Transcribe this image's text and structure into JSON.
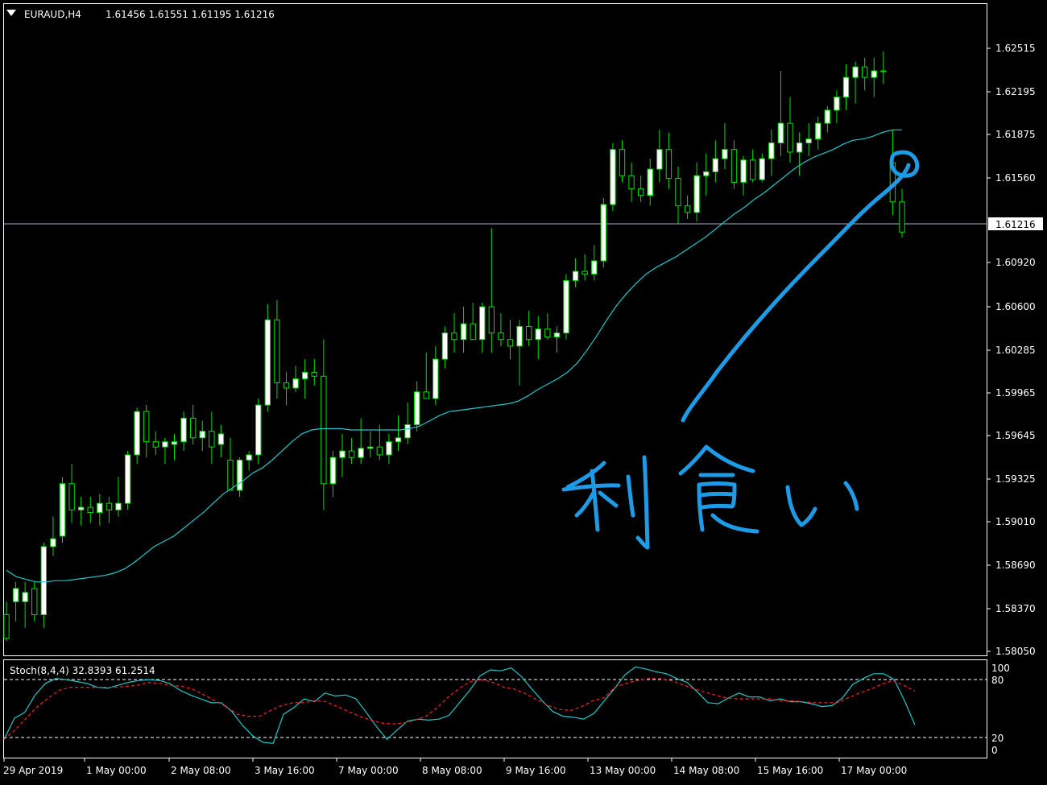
{
  "header": {
    "symbol": "EURAUD,H4",
    "ohlc": "1.61456 1.61551 1.61195 1.61216"
  },
  "stoch": {
    "label": "Stoch(8,4,4) 32.8393 61.2514",
    "levels": [
      "100",
      "80",
      "20",
      "0"
    ]
  },
  "annotation": {
    "text": "利食い"
  },
  "colors": {
    "background": "#000000",
    "frame": "#ffffff",
    "candle_up_body": "#ffffff",
    "candle_wick": "#00e000",
    "moving_average": "#20c8c8",
    "stoch_main": "#20c8c8",
    "stoch_signal": "#ff2020",
    "current_price_line": "#a0b4c8",
    "annotation": "#1e9be6"
  },
  "chart_data": [
    {
      "type": "line",
      "subtype": "candlestick",
      "title": "EURAUD,H4",
      "y_ticks": [
        "1.62515",
        "1.62195",
        "1.61875",
        "1.61560",
        "1.61216",
        "1.60920",
        "1.60600",
        "1.60285",
        "1.59965",
        "1.59645",
        "1.59325",
        "1.59010",
        "1.58690",
        "1.58370",
        "1.58050"
      ],
      "current_price": "1.61216",
      "x_ticks": [
        "29 Apr 2019",
        "1 May 00:00",
        "2 May 08:00",
        "3 May 16:00",
        "7 May 00:00",
        "8 May 08:00",
        "9 May 16:00",
        "13 May 00:00",
        "14 May 08:00",
        "15 May 16:00",
        "17 May 00:00"
      ],
      "ylim": [
        1.5799,
        1.6296
      ],
      "candles": [
        [
          1.583,
          1.584,
          1.581,
          1.5812
        ],
        [
          1.584,
          1.5855,
          1.5825,
          1.585
        ],
        [
          1.584,
          1.5855,
          1.582,
          1.5847
        ],
        [
          1.585,
          1.5855,
          1.5825,
          1.583
        ],
        [
          1.583,
          1.5885,
          1.582,
          1.5882
        ],
        [
          1.5882,
          1.5905,
          1.5875,
          1.5888
        ],
        [
          1.589,
          1.5935,
          1.5885,
          1.593
        ],
        [
          1.593,
          1.5945,
          1.59,
          1.591
        ],
        [
          1.591,
          1.592,
          1.5898,
          1.5912
        ],
        [
          1.5912,
          1.592,
          1.59,
          1.5908
        ],
        [
          1.5908,
          1.5922,
          1.5898,
          1.5915
        ],
        [
          1.5915,
          1.592,
          1.59,
          1.591
        ],
        [
          1.591,
          1.5935,
          1.5905,
          1.5915
        ],
        [
          1.5915,
          1.5955,
          1.591,
          1.5952
        ],
        [
          1.5952,
          1.5988,
          1.5945,
          1.5985
        ],
        [
          1.5985,
          1.599,
          1.595,
          1.5962
        ],
        [
          1.5962,
          1.597,
          1.5952,
          1.5958
        ],
        [
          1.5958,
          1.5965,
          1.5945,
          1.5962
        ],
        [
          1.596,
          1.5968,
          1.5948,
          1.5962
        ],
        [
          1.5962,
          1.5985,
          1.5955,
          1.598
        ],
        [
          1.598,
          1.599,
          1.596,
          1.5965
        ],
        [
          1.5965,
          1.5978,
          1.5955,
          1.597
        ],
        [
          1.597,
          1.5985,
          1.5945,
          1.5958
        ],
        [
          1.596,
          1.5975,
          1.595,
          1.5968
        ],
        [
          1.5948,
          1.5965,
          1.593,
          1.5925
        ],
        [
          1.5925,
          1.595,
          1.592,
          1.5948
        ],
        [
          1.5948,
          1.5955,
          1.594,
          1.5952
        ],
        [
          1.5952,
          1.5995,
          1.5945,
          1.599
        ],
        [
          1.599,
          1.6067,
          1.5985,
          1.6055
        ],
        [
          1.6055,
          1.607,
          1.5995,
          1.6007
        ],
        [
          1.6007,
          1.6015,
          1.599,
          1.6003
        ],
        [
          1.6003,
          1.602,
          1.6,
          1.601
        ],
        [
          1.601,
          1.6025,
          1.5995,
          1.6015
        ],
        [
          1.6015,
          1.6025,
          1.6005,
          1.6012
        ],
        [
          1.6012,
          1.604,
          1.591,
          1.593
        ],
        [
          1.593,
          1.5955,
          1.592,
          1.595
        ],
        [
          1.595,
          1.5968,
          1.5935,
          1.5955
        ],
        [
          1.5955,
          1.5965,
          1.5945,
          1.595
        ],
        [
          1.595,
          1.598,
          1.5945,
          1.5957
        ],
        [
          1.5957,
          1.597,
          1.595,
          1.5958
        ],
        [
          1.5958,
          1.5975,
          1.5948,
          1.5952
        ],
        [
          1.5952,
          1.5968,
          1.5945,
          1.5962
        ],
        [
          1.5962,
          1.5982,
          1.5955,
          1.5965
        ],
        [
          1.5965,
          1.5992,
          1.596,
          1.5975
        ],
        [
          1.5975,
          1.6008,
          1.597,
          1.6
        ],
        [
          1.6,
          1.603,
          1.5995,
          1.5995
        ],
        [
          1.5995,
          1.6035,
          1.599,
          1.6025
        ],
        [
          1.6025,
          1.605,
          1.6018,
          1.6045
        ],
        [
          1.6045,
          1.606,
          1.603,
          1.604
        ],
        [
          1.604,
          1.6065,
          1.603,
          1.6052
        ],
        [
          1.6052,
          1.6068,
          1.604,
          1.604
        ],
        [
          1.604,
          1.6068,
          1.603,
          1.6065
        ],
        [
          1.6065,
          1.6125,
          1.603,
          1.6045
        ],
        [
          1.6045,
          1.606,
          1.6035,
          1.604
        ],
        [
          1.604,
          1.6055,
          1.6025,
          1.6035
        ],
        [
          1.6035,
          1.6055,
          1.6005,
          1.605
        ],
        [
          1.605,
          1.6062,
          1.6035,
          1.604
        ],
        [
          1.604,
          1.6058,
          1.6025,
          1.6048
        ],
        [
          1.6048,
          1.606,
          1.604,
          1.6042
        ],
        [
          1.6042,
          1.605,
          1.603,
          1.6045
        ],
        [
          1.6045,
          1.609,
          1.604,
          1.6085
        ],
        [
          1.6085,
          1.6102,
          1.608,
          1.6092
        ],
        [
          1.6092,
          1.6105,
          1.6085,
          1.609
        ],
        [
          1.609,
          1.6112,
          1.6085,
          1.61
        ],
        [
          1.61,
          1.6148,
          1.6095,
          1.6143
        ],
        [
          1.6143,
          1.619,
          1.6138,
          1.6185
        ],
        [
          1.6185,
          1.6192,
          1.616,
          1.6165
        ],
        [
          1.6165,
          1.6175,
          1.6145,
          1.6155
        ],
        [
          1.6155,
          1.6165,
          1.6145,
          1.615
        ],
        [
          1.615,
          1.6178,
          1.6142,
          1.617
        ],
        [
          1.617,
          1.62,
          1.616,
          1.6185
        ],
        [
          1.6185,
          1.6198,
          1.6155,
          1.6163
        ],
        [
          1.6163,
          1.6172,
          1.6128,
          1.6142
        ],
        [
          1.6142,
          1.615,
          1.6132,
          1.6137
        ],
        [
          1.6137,
          1.6175,
          1.613,
          1.6165
        ],
        [
          1.6165,
          1.6182,
          1.615,
          1.6168
        ],
        [
          1.6168,
          1.6192,
          1.616,
          1.6178
        ],
        [
          1.6178,
          1.6205,
          1.617,
          1.6185
        ],
        [
          1.6185,
          1.6192,
          1.6155,
          1.616
        ],
        [
          1.616,
          1.618,
          1.615,
          1.6177
        ],
        [
          1.6177,
          1.6185,
          1.616,
          1.6162
        ],
        [
          1.6162,
          1.6182,
          1.616,
          1.6178
        ],
        [
          1.6178,
          1.62,
          1.6165,
          1.619
        ],
        [
          1.619,
          1.6245,
          1.618,
          1.6205
        ],
        [
          1.6205,
          1.6225,
          1.6175,
          1.6183
        ],
        [
          1.6183,
          1.6198,
          1.6165,
          1.619
        ],
        [
          1.619,
          1.6205,
          1.618,
          1.6193
        ],
        [
          1.6193,
          1.621,
          1.6185,
          1.6205
        ],
        [
          1.6205,
          1.6218,
          1.6198,
          1.6215
        ],
        [
          1.6215,
          1.623,
          1.6205,
          1.6225
        ],
        [
          1.6225,
          1.625,
          1.6215,
          1.624
        ],
        [
          1.624,
          1.6252,
          1.622,
          1.6248
        ],
        [
          1.6248,
          1.6255,
          1.623,
          1.624
        ],
        [
          1.624,
          1.6255,
          1.6225,
          1.6245
        ],
        [
          1.6245,
          1.626,
          1.6235,
          1.6245
        ],
        [
          1.6175,
          1.62,
          1.6135,
          1.6145
        ],
        [
          1.6145,
          1.6155,
          1.6118,
          1.6122
        ]
      ],
      "series": [
        {
          "name": "",
          "kind": "moving-average",
          "values": [
            1.5864,
            1.5859,
            1.5857,
            1.5855,
            1.5855,
            1.5856,
            1.5856,
            1.5857,
            1.5858,
            1.5859,
            1.586,
            1.5862,
            1.5865,
            1.587,
            1.5876,
            1.5882,
            1.5886,
            1.589,
            1.5896,
            1.5902,
            1.5908,
            1.5915,
            1.5922,
            1.5927,
            1.5932,
            1.5938,
            1.5942,
            1.5948,
            1.5955,
            1.5962,
            1.5968,
            1.5971,
            1.5972,
            1.5972,
            1.5972,
            1.5971,
            1.5971,
            1.5971,
            1.5971,
            1.5971,
            1.5971,
            1.5972,
            1.5974,
            1.5978,
            1.5982,
            1.5985,
            1.5986,
            1.5987,
            1.5988,
            1.5989,
            1.599,
            1.5991,
            1.5993,
            1.5997,
            1.6002,
            1.6006,
            1.601,
            1.6015,
            1.6022,
            1.6032,
            1.6043,
            1.6055,
            1.6066,
            1.6075,
            1.6083,
            1.609,
            1.6095,
            1.6099,
            1.6103,
            1.6108,
            1.6113,
            1.6118,
            1.6124,
            1.613,
            1.6136,
            1.6141,
            1.6147,
            1.6152,
            1.6158,
            1.6164,
            1.617,
            1.6175,
            1.6179,
            1.6182,
            1.6185,
            1.6189,
            1.6192,
            1.6193,
            1.6195,
            1.6198,
            1.62,
            1.62
          ]
        }
      ]
    },
    {
      "type": "line",
      "title": "Stoch(8,4,4) 32.8393 61.2514",
      "ylim": [
        0,
        100
      ],
      "y_ticks": [
        "100",
        "80",
        "20",
        "0"
      ],
      "levels": [
        80,
        20
      ],
      "series": [
        {
          "name": "",
          "kind": "main",
          "values": [
            18,
            40,
            46,
            64,
            76,
            81,
            80,
            78,
            76,
            72,
            71,
            74,
            77,
            79,
            80,
            79,
            76,
            69,
            64,
            60,
            56,
            56,
            47,
            33,
            22,
            15,
            14,
            44,
            51,
            60,
            57,
            66,
            63,
            64,
            60,
            46,
            31,
            18,
            28,
            37,
            39,
            38,
            39,
            43,
            56,
            69,
            84,
            90,
            89,
            92,
            83,
            70,
            58,
            47,
            42,
            41,
            39,
            45,
            58,
            71,
            85,
            93,
            91,
            88,
            86,
            81,
            77,
            67,
            56,
            55,
            61,
            66,
            62,
            62,
            58,
            60,
            57,
            57,
            55,
            52,
            53,
            61,
            75,
            81,
            86,
            86,
            80,
            58,
            33
          ]
        },
        {
          "name": "",
          "kind": "signal",
          "values": [
            18,
            28,
            40,
            52,
            61,
            69,
            72,
            72,
            72,
            72,
            72,
            73,
            74,
            77,
            76,
            74,
            73,
            70,
            64,
            58,
            52,
            44,
            42,
            42,
            48,
            53,
            56,
            56,
            58,
            57,
            52,
            47,
            42,
            38,
            35,
            34,
            35,
            38,
            42,
            51,
            62,
            71,
            78,
            80,
            77,
            72,
            70,
            65,
            59,
            53,
            49,
            48,
            52,
            58,
            61,
            72,
            76,
            79,
            81,
            81,
            79,
            75,
            71,
            67,
            64,
            61,
            60,
            60,
            60,
            60,
            58,
            58,
            57,
            56,
            56,
            56,
            61,
            66,
            70,
            75,
            79,
            74,
            68
          ]
        }
      ]
    }
  ]
}
